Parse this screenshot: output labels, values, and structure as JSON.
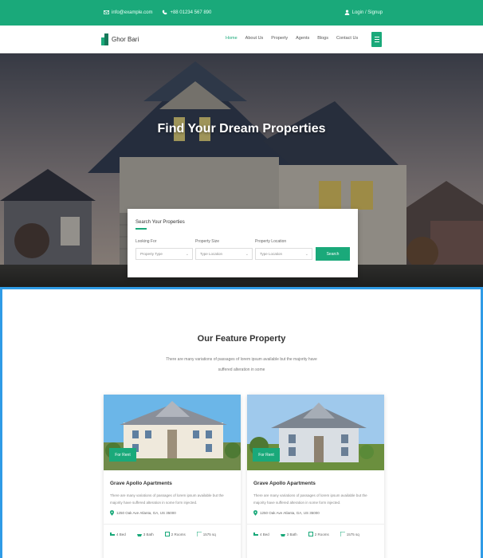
{
  "topbar": {
    "email": "info@example.com",
    "phone": "+88 01234 567 890",
    "login": "Login / Signup"
  },
  "brand": {
    "name": "Ghor Bari"
  },
  "nav": {
    "items": [
      {
        "label": "Home",
        "active": true
      },
      {
        "label": "About Us",
        "active": false
      },
      {
        "label": "Property",
        "active": false
      },
      {
        "label": "Agents",
        "active": false
      },
      {
        "label": "Blogs",
        "active": false
      },
      {
        "label": "Contact Us",
        "active": false
      }
    ]
  },
  "hero": {
    "title": "Find Your Dream Properties"
  },
  "search": {
    "heading": "Search Your Properties",
    "fields": [
      {
        "label": "Looking For",
        "value": "Property Type"
      },
      {
        "label": "Property Size",
        "value": "Type Location"
      },
      {
        "label": "Property Location",
        "value": "Type Location"
      }
    ],
    "button": "Search"
  },
  "feature": {
    "title": "Our Feature Property",
    "desc": "There are many variations of passages of lorem ipsum available but the majority have suffered alteration in some"
  },
  "cards": [
    {
      "badge": "For Rent",
      "name": "Grave Apollo Apartments",
      "desc": "There are many variations of passages of lorem ipsum available but the majority have suffered alteration in some form injected.",
      "address": "1250 Oak Ave Atlanta, GA, US 35000",
      "stats": [
        "4 Bed",
        "3 Bath",
        "2 Rooms",
        "1575 sq"
      ]
    },
    {
      "badge": "For Rent",
      "name": "Grave Apollo Apartments",
      "desc": "There are many variations of passages of lorem ipsum available but the majority have suffered alteration in some form injected.",
      "address": "1250 Oak Ave Atlanta, GA, US 35000",
      "stats": [
        "4 Bed",
        "3 Bath",
        "2 Rooms",
        "1575 sq"
      ]
    }
  ],
  "colors": {
    "brand": "#1aa97a",
    "accent_border": "#2f9be6"
  },
  "icons": {
    "email": "envelope-icon",
    "phone": "phone-icon",
    "login": "user-icon",
    "menu": "hamburger-icon",
    "location": "map-pin-icon",
    "bed": "bed-icon",
    "bath": "bath-icon",
    "rooms": "room-icon",
    "area": "area-icon"
  }
}
